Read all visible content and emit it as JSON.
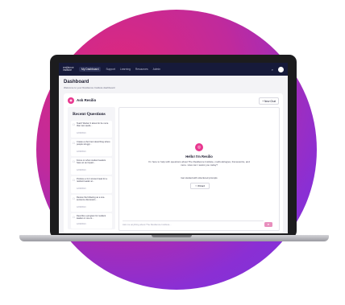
{
  "nav": {
    "logo": "resilience institute",
    "items": [
      {
        "label": "My Dashboard",
        "active": true
      },
      {
        "label": "Support"
      },
      {
        "label": "Learning"
      },
      {
        "label": "Resources"
      },
      {
        "label": "Admin"
      }
    ],
    "search_icon": "search-icon"
  },
  "dashboard": {
    "title": "Dashboard",
    "subtitle": "Welcome to your Resilience Institute dashboard"
  },
  "ask": {
    "title": "Ask Resilio",
    "new_chat": "+ New Chat"
  },
  "recent": {
    "title": "Recent Questions",
    "items": [
      {
        "text": "Teach Worker 3 about for be more than two seeds...",
        "date": "12/08/2024"
      },
      {
        "text": "Create a short text describing where people struggl...",
        "date": "12/08/2024"
      },
      {
        "text": "Focus on when student leaders have an as impact...",
        "date": "12/08/2024"
      },
      {
        "text": "Produce a 3-4 minute break for a resilient leader at...",
        "date": "12/08/2024"
      },
      {
        "text": "Review the following as a one-sentence discussion...",
        "date": "12/08/2024"
      },
      {
        "text": "Describe a program for resilient leaders in one to...",
        "date": "12/08/2024"
      }
    ]
  },
  "chat": {
    "hello": "Hello! I'm Resilio",
    "help": "I'm here to help with questions about The Resilience Institute, methodologies, frameworks, and more. How can I assist you today?",
    "started": "Get started with structured prompts",
    "wizard": "Wizard",
    "placeholder": "Ask me anything about The Resilience Institute..."
  },
  "colors": {
    "accent": "#e8378f",
    "nav_bg": "#161a3a",
    "gradient_start": "#e0287a",
    "gradient_end": "#7a35dc"
  }
}
